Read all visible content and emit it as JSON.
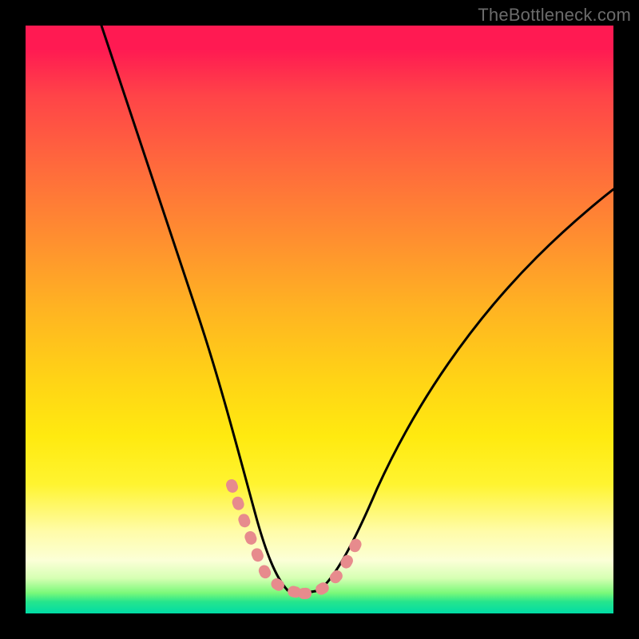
{
  "attribution": "TheBottleneck.com",
  "chart_data": {
    "type": "line",
    "title": "",
    "xlabel": "",
    "ylabel": "",
    "xlim": [
      0,
      100
    ],
    "ylim": [
      0,
      100
    ],
    "series": [
      {
        "name": "left-curve",
        "x": [
          13,
          16,
          19,
          22,
          25,
          28,
          31,
          33,
          35,
          37,
          38.5,
          40,
          41.5,
          43,
          44.5
        ],
        "y": [
          100,
          88,
          76,
          65,
          54,
          44,
          35,
          28,
          22,
          16,
          12,
          9,
          6.5,
          5,
          4
        ]
      },
      {
        "name": "right-curve",
        "x": [
          50,
          52,
          54,
          57,
          60,
          64,
          68,
          73,
          79,
          86,
          93,
          100
        ],
        "y": [
          4,
          6,
          9,
          13,
          18,
          24,
          30,
          37,
          45,
          54,
          63,
          72
        ]
      },
      {
        "name": "flat-bottom",
        "x": [
          44.5,
          46,
          47.5,
          49,
          50
        ],
        "y": [
          4,
          3.7,
          3.5,
          3.7,
          4
        ]
      },
      {
        "name": "pink-overlay-left",
        "x": [
          35,
          37,
          38.5,
          40,
          41.5,
          43,
          44.5,
          46,
          47.5
        ],
        "y": [
          22,
          16,
          12,
          9,
          6.5,
          5,
          4,
          3.7,
          3.5
        ]
      },
      {
        "name": "pink-overlay-right",
        "x": [
          47.5,
          49,
          50,
          52,
          54,
          57
        ],
        "y": [
          3.5,
          3.7,
          4,
          6,
          9,
          13
        ]
      }
    ],
    "gradient_stops": [
      {
        "pos": 0,
        "color": "#ff1a52"
      },
      {
        "pos": 24,
        "color": "#ff6a3c"
      },
      {
        "pos": 48,
        "color": "#ffb322"
      },
      {
        "pos": 70,
        "color": "#ffea10"
      },
      {
        "pos": 91,
        "color": "#fbffd7"
      },
      {
        "pos": 98,
        "color": "#26e58c"
      },
      {
        "pos": 100,
        "color": "#00dca6"
      }
    ]
  }
}
